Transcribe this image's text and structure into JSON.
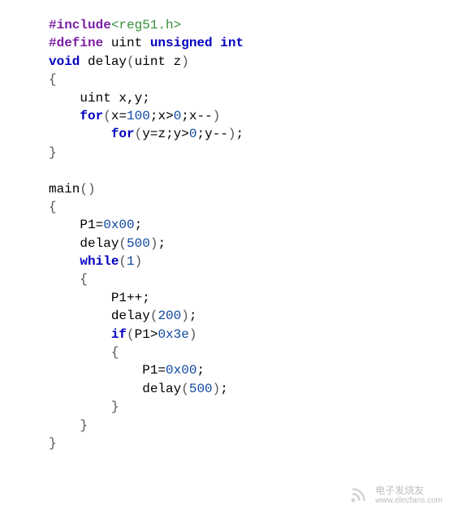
{
  "code": {
    "lines": [
      {
        "indent": 0,
        "tokens": [
          {
            "cls": "token-directive",
            "t": "#include"
          },
          {
            "cls": "token-header",
            "t": "<reg51.h>"
          }
        ]
      },
      {
        "indent": 0,
        "tokens": [
          {
            "cls": "token-directive",
            "t": "#define"
          },
          {
            "cls": "token-identifier",
            "t": " uint "
          },
          {
            "cls": "token-keyword",
            "t": "unsigned int"
          }
        ]
      },
      {
        "indent": 0,
        "tokens": [
          {
            "cls": "token-keyword",
            "t": "void"
          },
          {
            "cls": "token-identifier",
            "t": " delay"
          },
          {
            "cls": "token-paren",
            "t": "("
          },
          {
            "cls": "token-identifier",
            "t": "uint z"
          },
          {
            "cls": "token-paren",
            "t": ")"
          }
        ]
      },
      {
        "indent": 0,
        "tokens": [
          {
            "cls": "token-brace",
            "t": "{"
          }
        ]
      },
      {
        "indent": 1,
        "tokens": [
          {
            "cls": "token-identifier",
            "t": "uint x"
          },
          {
            "cls": "token-comma",
            "t": ","
          },
          {
            "cls": "token-identifier",
            "t": "y"
          },
          {
            "cls": "token-semicolon",
            "t": ";"
          }
        ]
      },
      {
        "indent": 1,
        "tokens": [
          {
            "cls": "token-keyword",
            "t": "for"
          },
          {
            "cls": "token-paren",
            "t": "("
          },
          {
            "cls": "token-identifier",
            "t": "x"
          },
          {
            "cls": "token-operator",
            "t": "="
          },
          {
            "cls": "token-number",
            "t": "100"
          },
          {
            "cls": "token-semicolon",
            "t": ";"
          },
          {
            "cls": "token-identifier",
            "t": "x"
          },
          {
            "cls": "token-operator",
            "t": ">"
          },
          {
            "cls": "token-number",
            "t": "0"
          },
          {
            "cls": "token-semicolon",
            "t": ";"
          },
          {
            "cls": "token-identifier",
            "t": "x"
          },
          {
            "cls": "token-operator",
            "t": "--"
          },
          {
            "cls": "token-paren",
            "t": ")"
          }
        ]
      },
      {
        "indent": 2,
        "tokens": [
          {
            "cls": "token-keyword",
            "t": "for"
          },
          {
            "cls": "token-paren",
            "t": "("
          },
          {
            "cls": "token-identifier",
            "t": "y"
          },
          {
            "cls": "token-operator",
            "t": "="
          },
          {
            "cls": "token-identifier",
            "t": "z"
          },
          {
            "cls": "token-semicolon",
            "t": ";"
          },
          {
            "cls": "token-identifier",
            "t": "y"
          },
          {
            "cls": "token-operator",
            "t": ">"
          },
          {
            "cls": "token-number",
            "t": "0"
          },
          {
            "cls": "token-semicolon",
            "t": ";"
          },
          {
            "cls": "token-identifier",
            "t": "y"
          },
          {
            "cls": "token-operator",
            "t": "--"
          },
          {
            "cls": "token-paren",
            "t": ")"
          },
          {
            "cls": "token-semicolon",
            "t": ";"
          }
        ]
      },
      {
        "indent": 0,
        "tokens": [
          {
            "cls": "token-brace",
            "t": "}"
          }
        ]
      },
      {
        "indent": 0,
        "tokens": []
      },
      {
        "indent": 0,
        "tokens": [
          {
            "cls": "token-identifier",
            "t": "main"
          },
          {
            "cls": "token-paren",
            "t": "()"
          }
        ]
      },
      {
        "indent": 0,
        "tokens": [
          {
            "cls": "token-brace",
            "t": "{"
          }
        ]
      },
      {
        "indent": 1,
        "tokens": [
          {
            "cls": "token-identifier",
            "t": "P1"
          },
          {
            "cls": "token-operator",
            "t": "="
          },
          {
            "cls": "token-hex",
            "t": "0x00"
          },
          {
            "cls": "token-semicolon",
            "t": ";"
          }
        ]
      },
      {
        "indent": 1,
        "tokens": [
          {
            "cls": "token-identifier",
            "t": "delay"
          },
          {
            "cls": "token-paren",
            "t": "("
          },
          {
            "cls": "token-number",
            "t": "500"
          },
          {
            "cls": "token-paren",
            "t": ")"
          },
          {
            "cls": "token-semicolon",
            "t": ";"
          }
        ]
      },
      {
        "indent": 1,
        "tokens": [
          {
            "cls": "token-keyword",
            "t": "while"
          },
          {
            "cls": "token-paren",
            "t": "("
          },
          {
            "cls": "token-number",
            "t": "1"
          },
          {
            "cls": "token-paren",
            "t": ")"
          }
        ]
      },
      {
        "indent": 1,
        "tokens": [
          {
            "cls": "token-brace",
            "t": "{"
          }
        ]
      },
      {
        "indent": 2,
        "tokens": [
          {
            "cls": "token-identifier",
            "t": "P1"
          },
          {
            "cls": "token-operator",
            "t": "++"
          },
          {
            "cls": "token-semicolon",
            "t": ";"
          }
        ]
      },
      {
        "indent": 2,
        "tokens": [
          {
            "cls": "token-identifier",
            "t": "delay"
          },
          {
            "cls": "token-paren",
            "t": "("
          },
          {
            "cls": "token-number",
            "t": "200"
          },
          {
            "cls": "token-paren",
            "t": ")"
          },
          {
            "cls": "token-semicolon",
            "t": ";"
          }
        ]
      },
      {
        "indent": 2,
        "tokens": [
          {
            "cls": "token-keyword",
            "t": "if"
          },
          {
            "cls": "token-paren",
            "t": "("
          },
          {
            "cls": "token-identifier",
            "t": "P1"
          },
          {
            "cls": "token-operator",
            "t": ">"
          },
          {
            "cls": "token-hex",
            "t": "0x3e"
          },
          {
            "cls": "token-paren",
            "t": ")"
          }
        ]
      },
      {
        "indent": 2,
        "tokens": [
          {
            "cls": "token-brace",
            "t": "{"
          }
        ]
      },
      {
        "indent": 3,
        "tokens": [
          {
            "cls": "token-identifier",
            "t": "P1"
          },
          {
            "cls": "token-operator",
            "t": "="
          },
          {
            "cls": "token-hex",
            "t": "0x00"
          },
          {
            "cls": "token-semicolon",
            "t": ";"
          }
        ]
      },
      {
        "indent": 3,
        "tokens": [
          {
            "cls": "token-identifier",
            "t": "delay"
          },
          {
            "cls": "token-paren",
            "t": "("
          },
          {
            "cls": "token-number",
            "t": "500"
          },
          {
            "cls": "token-paren",
            "t": ")"
          },
          {
            "cls": "token-semicolon",
            "t": ";"
          }
        ]
      },
      {
        "indent": 2,
        "tokens": [
          {
            "cls": "token-brace",
            "t": "}"
          }
        ]
      },
      {
        "indent": 1,
        "tokens": [
          {
            "cls": "token-brace",
            "t": "}"
          }
        ]
      },
      {
        "indent": 0,
        "tokens": [
          {
            "cls": "token-brace",
            "t": "}"
          }
        ]
      }
    ]
  },
  "watermark": {
    "cn": "电子发烧友",
    "url": "www.elecfans.com"
  }
}
